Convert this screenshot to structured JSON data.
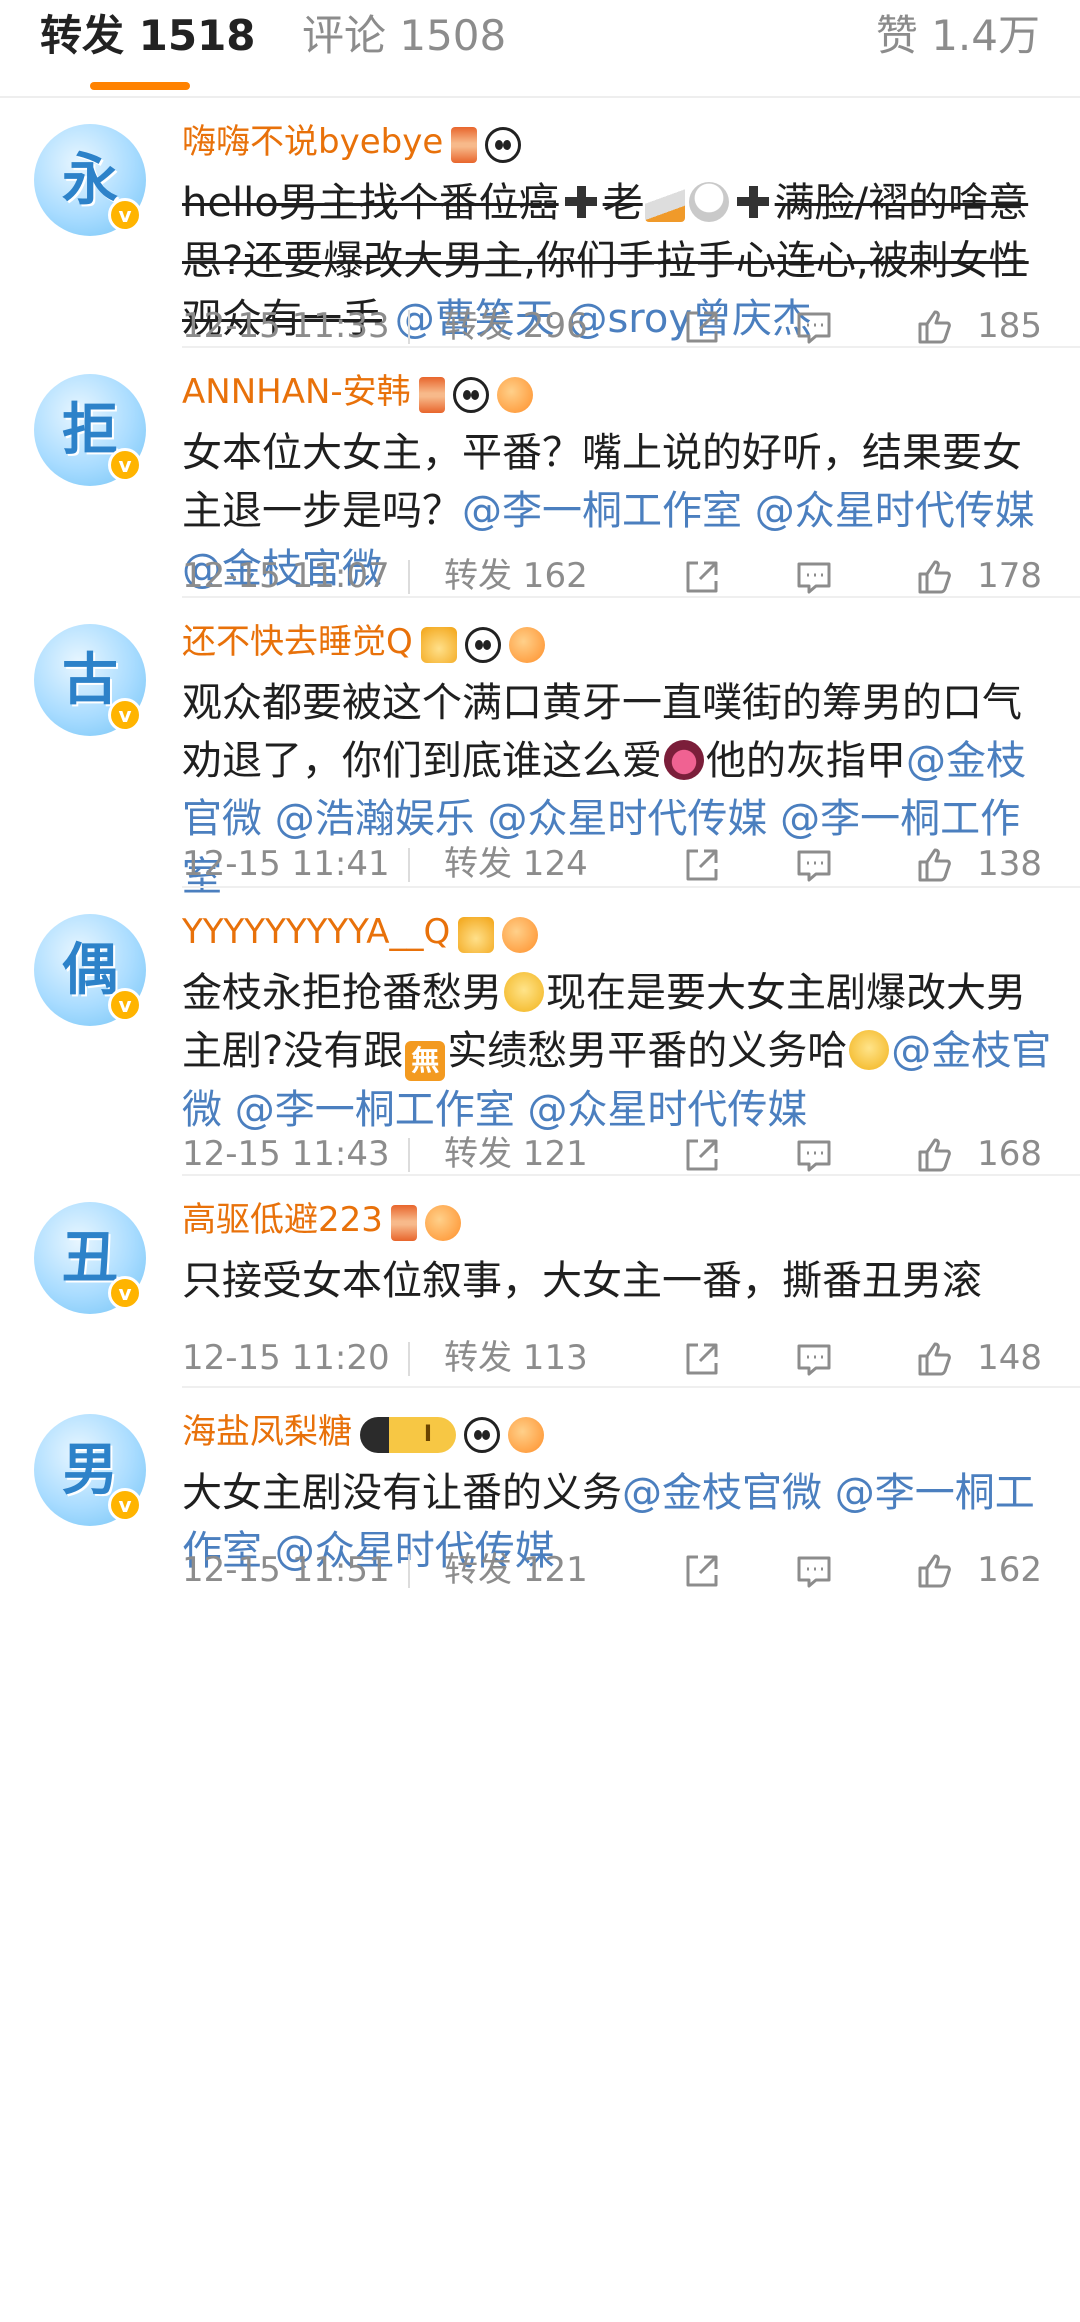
{
  "tabs": {
    "repost": "转发 1518",
    "comment": "评论 1508",
    "like": "赞 1.4万",
    "accent_color": "#ff8200"
  },
  "items": [
    {
      "avatar_char": "永",
      "username": "嗨嗨不说byebye",
      "badges": [
        "hourglass-icon",
        "panda-icon"
      ],
      "segments": [
        {
          "t": "hello男主找个番位癌",
          "s": true
        },
        {
          "e": "plus-emoji"
        },
        {
          "t": "老",
          "s": true
        },
        {
          "e": "cigarette-emoji"
        },
        {
          "e": "ghost-emoji"
        },
        {
          "e": "plus-emoji"
        },
        {
          "t": "满脸/褶的啥意思?还要爆改大男主,你们手拉手心连心,被刺女性观众有一手",
          "s": true
        },
        {
          "t": " "
        },
        {
          "t": "@曹笑天",
          "m": true
        },
        {
          "t": " "
        },
        {
          "t": "@sroy曾庆杰",
          "m": true
        }
      ],
      "time": "12-15 11:33",
      "reposts": "转发 296",
      "likes": "185"
    },
    {
      "avatar_char": "拒",
      "username": "ANNHAN-安韩",
      "badges": [
        "hourglass-icon",
        "panda-icon",
        "pufferfish-icon"
      ],
      "segments": [
        {
          "t": "女本位大女主，平番？嘴上说的好听，结果要女主退一步是吗？"
        },
        {
          "t": "@李一桐工作室",
          "m": true
        },
        {
          "t": " "
        },
        {
          "t": "@众星时代传媒",
          "m": true
        },
        {
          "t": " "
        },
        {
          "t": "@金枝官微",
          "m": true
        }
      ],
      "time": "12-15 11:07",
      "reposts": "转发 162",
      "likes": "178"
    },
    {
      "avatar_char": "古",
      "username": "还不快去睡觉Q",
      "badges": [
        "crown-icon",
        "panda-icon",
        "pufferfish-icon"
      ],
      "segments": [
        {
          "t": "观众都要被这个满口黄牙一直噗街的筹男的口气劝退了，你们到底谁这么爱"
        },
        {
          "e": "tongue-emoji"
        },
        {
          "t": "他的灰指甲"
        },
        {
          "t": "@金枝官微",
          "m": true
        },
        {
          "t": " "
        },
        {
          "t": "@浩瀚娱乐",
          "m": true
        },
        {
          "t": " "
        },
        {
          "t": "@众星时代传媒",
          "m": true
        },
        {
          "t": " "
        },
        {
          "t": "@李一桐工作室",
          "m": true
        }
      ],
      "time": "12-15 11:41",
      "reposts": "转发 124",
      "likes": "138"
    },
    {
      "avatar_char": "偶",
      "username": "YYYYYYYYYA__Q",
      "badges": [
        "crown-icon",
        "pufferfish-icon"
      ],
      "segments": [
        {
          "t": "金枝永拒抢番愁男"
        },
        {
          "e": "smile-emoji"
        },
        {
          "t": "现在是要大女主剧爆改大男主剧?没有跟"
        },
        {
          "e": "wu-emoji"
        },
        {
          "t": "实绩愁男平番的义务哈"
        },
        {
          "e": "smile-emoji"
        },
        {
          "t": "@金枝官微",
          "m": true
        },
        {
          "t": " "
        },
        {
          "t": "@李一桐工作室",
          "m": true
        },
        {
          "t": " "
        },
        {
          "t": "@众星时代传媒",
          "m": true
        }
      ],
      "time": "12-15 11:43",
      "reposts": "转发 121",
      "likes": "168"
    },
    {
      "avatar_char": "丑",
      "username": "高驱低避223",
      "badges": [
        "hourglass-icon",
        "pufferfish-icon"
      ],
      "segments": [
        {
          "t": "只接受女本位叙事，大女主一番，撕番丑男滚"
        }
      ],
      "time": "12-15 11:20",
      "reposts": "转发 113",
      "likes": "148"
    },
    {
      "avatar_char": "男",
      "username": "海盐凤梨糖",
      "badges": [
        "vip-icon",
        "panda-icon",
        "pufferfish-icon"
      ],
      "segments": [
        {
          "t": "大女主剧没有让番的义务"
        },
        {
          "t": "@金枝官微",
          "m": true
        },
        {
          "t": " "
        },
        {
          "t": "@李一桐工作室",
          "m": true
        },
        {
          "t": " "
        },
        {
          "t": "@众星时代传媒",
          "m": true
        }
      ],
      "time": "12-15 11:51",
      "reposts": "转发 121",
      "likes": "162"
    }
  ],
  "vip_label": "I",
  "wu_emoji_char": "無"
}
